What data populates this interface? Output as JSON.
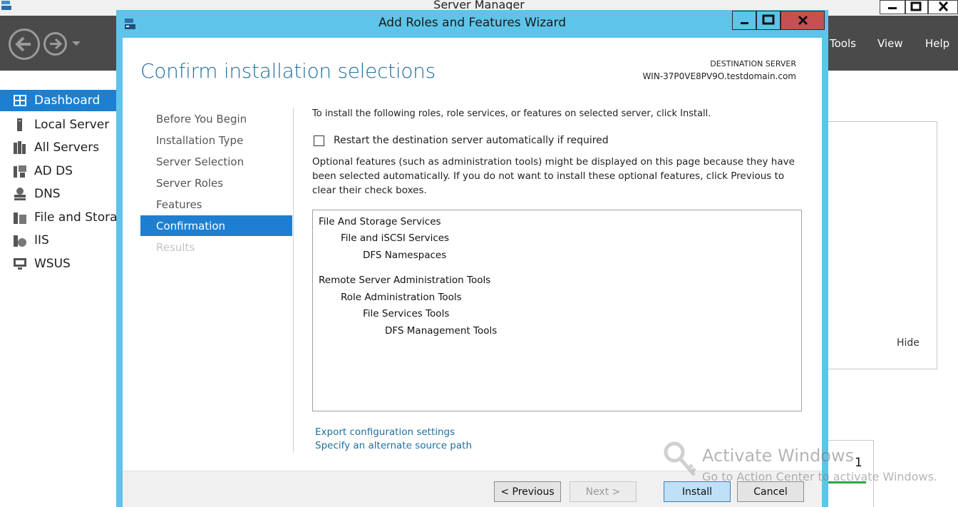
{
  "server_manager": {
    "title": "Server Manager",
    "menu": {
      "tools": "Tools",
      "view": "View",
      "help": "Help"
    },
    "sidebar": [
      {
        "label": "Dashboard",
        "icon": "dashboard-icon",
        "active": true
      },
      {
        "label": "Local Server",
        "icon": "local-server-icon"
      },
      {
        "label": "All Servers",
        "icon": "all-servers-icon"
      },
      {
        "label": "AD DS",
        "icon": "ad-ds-icon"
      },
      {
        "label": "DNS",
        "icon": "dns-icon"
      },
      {
        "label": "File and Storag",
        "icon": "file-storage-icon"
      },
      {
        "label": "IIS",
        "icon": "iis-icon"
      },
      {
        "label": "WSUS",
        "icon": "wsus-icon"
      }
    ],
    "hide_label": "Hide",
    "count": "1"
  },
  "wizard": {
    "title": "Add Roles and Features Wizard",
    "page_title": "Confirm installation selections",
    "destination_label": "DESTINATION SERVER",
    "destination_name": "WIN-37P0VE8PV9O.testdomain.com",
    "steps": [
      {
        "label": "Before You Begin",
        "state": "normal"
      },
      {
        "label": "Installation Type",
        "state": "normal"
      },
      {
        "label": "Server Selection",
        "state": "normal"
      },
      {
        "label": "Server Roles",
        "state": "normal"
      },
      {
        "label": "Features",
        "state": "normal"
      },
      {
        "label": "Confirmation",
        "state": "active"
      },
      {
        "label": "Results",
        "state": "disabled"
      }
    ],
    "intro": "To install the following roles, role services, or features on selected server, click Install.",
    "restart_checkbox": {
      "label": "Restart the destination server automatically if required",
      "checked": false
    },
    "optional_text": "Optional features (such as administration tools) might be displayed on this page because they have been selected automatically. If you do not want to install these optional features, click Previous to clear their check boxes.",
    "selections": [
      {
        "label": "File And Storage Services",
        "level": 0
      },
      {
        "label": "File and iSCSI Services",
        "level": 1
      },
      {
        "label": "DFS Namespaces",
        "level": 2
      },
      {
        "label": "Remote Server Administration Tools",
        "level": 0
      },
      {
        "label": "Role Administration Tools",
        "level": 1
      },
      {
        "label": "File Services Tools",
        "level": 2
      },
      {
        "label": "DFS Management Tools",
        "level": 3
      }
    ],
    "links": {
      "export": "Export configuration settings",
      "alternate_source": "Specify an alternate source path"
    },
    "buttons": {
      "previous": "< Previous",
      "next": "Next >",
      "install": "Install",
      "cancel": "Cancel"
    }
  },
  "watermark": {
    "title": "Activate Windows",
    "subtitle": "Go to Action Center to activate Windows."
  },
  "colors": {
    "wizard_frame": "#5ec4e9",
    "accent_blue": "#1e7fd0",
    "title_blue": "#1e6fa0",
    "close_red": "#c75050",
    "toolbar_dark": "#4a4a4a"
  }
}
